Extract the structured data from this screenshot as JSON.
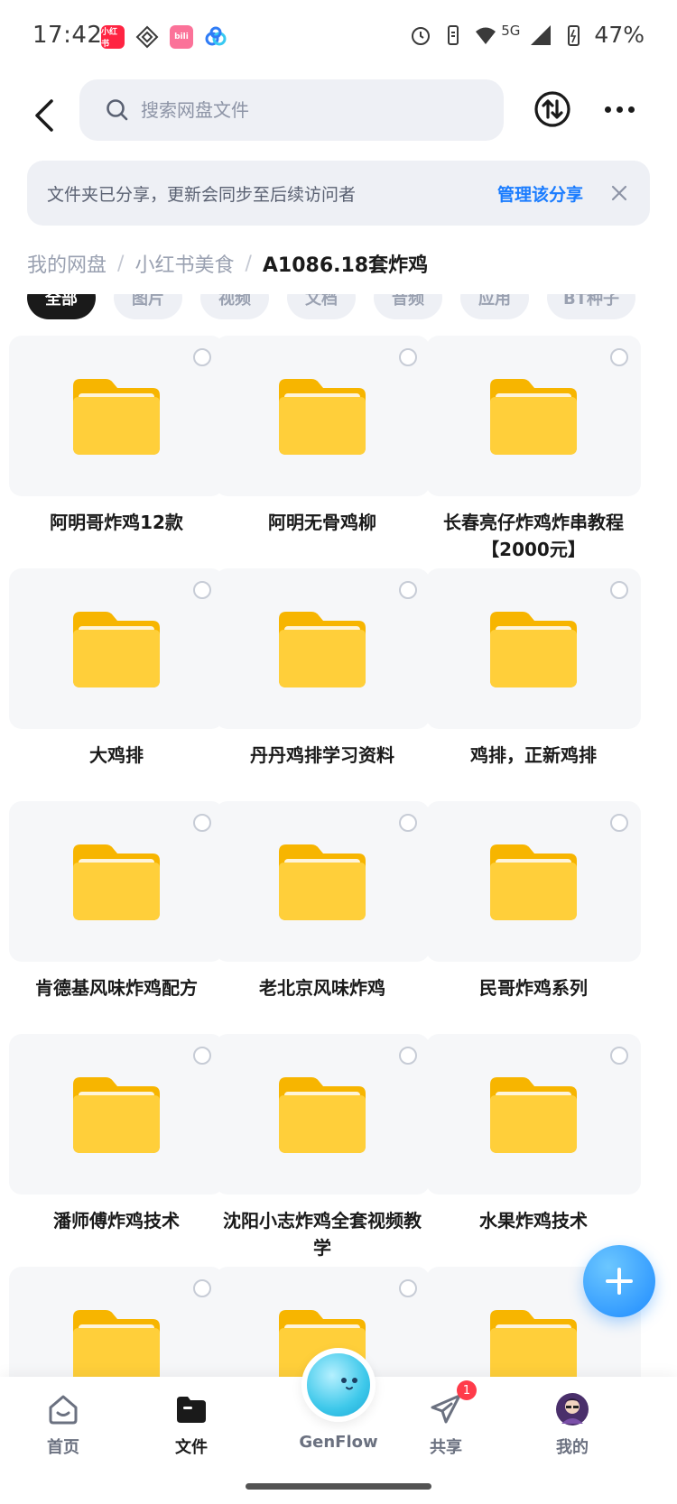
{
  "status_bar": {
    "time": "17:42",
    "network": "5G",
    "battery": "47%",
    "app_icons": [
      "xiaohongshu-icon",
      "kuai-icon",
      "bilibili-icon",
      "baidu-netdisk-icon"
    ]
  },
  "header": {
    "search_placeholder": "搜索网盘文件"
  },
  "banner": {
    "text": "文件夹已分享，更新会同步至后续访问者",
    "link_label": "管理该分享"
  },
  "breadcrumb": {
    "items": [
      "我的网盘",
      "小红书美食"
    ],
    "current": "A1086.18套炸鸡"
  },
  "filters": {
    "items": [
      "全部",
      "图片",
      "视频",
      "文档",
      "音频",
      "应用",
      "BT种子"
    ],
    "active_index": 0
  },
  "folders": [
    {
      "name": "阿明哥炸鸡12款"
    },
    {
      "name": "阿明无骨鸡柳"
    },
    {
      "name": "长春亮仔炸鸡炸串教程【2000元】"
    },
    {
      "name": "大鸡排"
    },
    {
      "name": "丹丹鸡排学习资料"
    },
    {
      "name": "鸡排，正新鸡排"
    },
    {
      "name": "肯德基风味炸鸡配方"
    },
    {
      "name": "老北京风味炸鸡"
    },
    {
      "name": "民哥炸鸡系列"
    },
    {
      "name": "潘师傅炸鸡技术"
    },
    {
      "name": "沈阳小志炸鸡全套视频教学"
    },
    {
      "name": "水果炸鸡技术"
    }
  ],
  "bottom_nav": {
    "items": [
      {
        "label": "首页",
        "icon": "home-icon"
      },
      {
        "label": "文件",
        "icon": "folder-icon"
      },
      {
        "label": "GenFlow",
        "icon": "genflow-icon"
      },
      {
        "label": "共享",
        "icon": "share-icon",
        "badge": "1"
      },
      {
        "label": "我的",
        "icon": "avatar-icon"
      }
    ],
    "active_index": 1
  },
  "colors": {
    "accent": "#1a7cff",
    "folder": "#ffc92e",
    "badge": "#ff3b4a"
  }
}
